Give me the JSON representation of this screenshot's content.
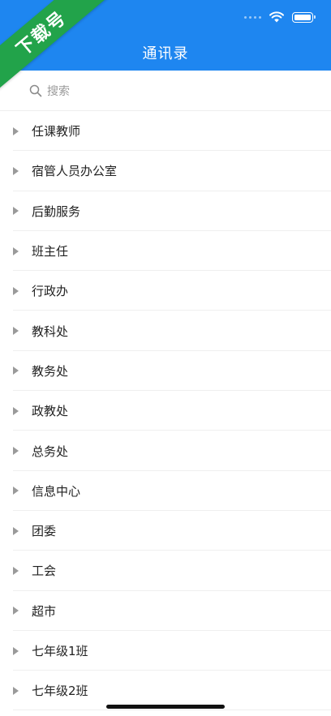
{
  "header": {
    "title": "通讯录"
  },
  "watermark": {
    "text": "下载号"
  },
  "search": {
    "placeholder": "搜索"
  },
  "groups": [
    {
      "label": "任课教师"
    },
    {
      "label": "宿管人员办公室"
    },
    {
      "label": "后勤服务"
    },
    {
      "label": "班主任"
    },
    {
      "label": "行政办"
    },
    {
      "label": "教科处"
    },
    {
      "label": "教务处"
    },
    {
      "label": "政教处"
    },
    {
      "label": "总务处"
    },
    {
      "label": "信息中心"
    },
    {
      "label": "团委"
    },
    {
      "label": "工会"
    },
    {
      "label": "超市"
    },
    {
      "label": "七年级1班"
    },
    {
      "label": "七年级2班"
    }
  ],
  "colors": {
    "header": "#1E86F0",
    "badge": "#22A34A"
  }
}
